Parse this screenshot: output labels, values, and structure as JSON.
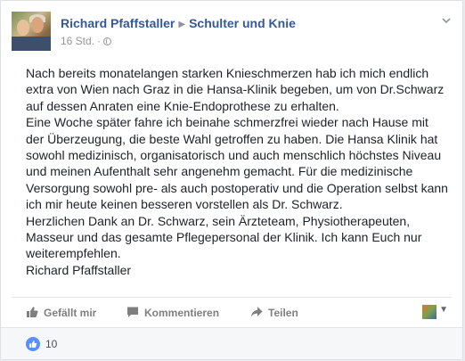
{
  "post": {
    "author": "Richard Pfaffstaller",
    "target": "Schulter und Knie",
    "time": "16 Std.",
    "dot": "·",
    "lines": [
      "Nach bereits monatelangen starken Knieschmerzen hab ich mich endlich",
      "extra von Wien nach Graz in die Hansa-Klinik begeben, um von Dr.Schwarz",
      "auf dessen Anraten eine Knie-Endoprothese zu erhalten.",
      "Eine Woche später fahre ich beinahe schmerzfrei wieder nach Hause mit",
      "der Überzeugung, die beste Wahl getroffen zu haben. Die Hansa Klinik hat",
      "sowohl medizinisch, organisatorisch und auch menschlich höchstes Niveau",
      "und meinen Aufenthalt sehr angenehm gemacht. Für die medizinische",
      "Versorgung sowohl pre- als auch postoperativ und die Operation selbst kann",
      "ich mir heute keinen besseren vorstellen als Dr. Schwarz.",
      "Herzlichen Dank an Dr. Schwarz, sein Ärzteteam, Physiotherapeuten,",
      "Masseur und das gesamte Pflegepersonal der Klinik. Ich kann Euch nur",
      "weiterempfehlen.",
      "Richard Pfaffstaller"
    ]
  },
  "actions": {
    "like": "Gefällt mir",
    "comment": "Kommentieren",
    "share": "Teilen"
  },
  "reactions": {
    "count": "10"
  },
  "icons": {
    "like": "thumbs-up-icon",
    "comment": "speech-bubble-icon",
    "share": "share-arrow-icon",
    "privacy": "globe-icon",
    "menu": "chevron-down-icon"
  },
  "colors": {
    "link": "#365899",
    "like_bubble": "#5890ff",
    "muted": "#90949c"
  }
}
